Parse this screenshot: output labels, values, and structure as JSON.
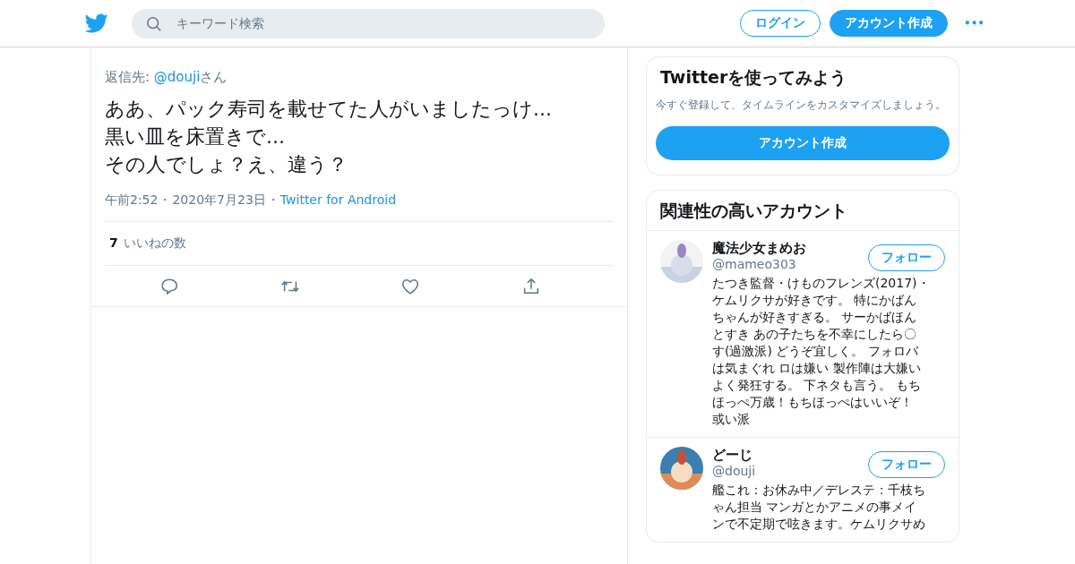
{
  "header": {
    "search": {
      "placeholder": "キーワード検索"
    },
    "login": "ログイン",
    "signup": "アカウント作成",
    "more": "•••"
  },
  "tweet": {
    "reply_label": "返信先:",
    "reply_to": "@douji",
    "reply_suffix": "さん",
    "lines": [
      "ああ、パック寿司を載せてた人がいましたっけ...",
      "黒い皿を床置きで...",
      "その人でしょ？え、違う？"
    ],
    "time": "午前2:52",
    "date": "2020年7月23日",
    "source": "Twitter for Android",
    "separator": "・",
    "likes": "7",
    "likes_label": "いいねの数"
  },
  "signup_card": {
    "title": "Twitterを使ってみよう",
    "text": "今すぐ登録して、タイムラインをカスタマイズしましょう。",
    "button": "アカウント作成"
  },
  "related": {
    "title": "関連性の高いアカウント",
    "accounts": [
      {
        "name": "魔法少女まめお",
        "handle": "@mameo303",
        "button": "フォロー",
        "bio": [
          "たつき監督・けものフレンズ(2017)・",
          "ケムリクサが好きです。 特にかばん",
          "ちゃんが好きすぎる。 サーかばほん",
          "とすき あの子たちを不幸にしたら〇",
          "す(過激派) どうぞ宜しく。 フォロバ",
          "は気まぐれ ロは嫌い 製作陣は大嫌い",
          "よく発狂する。 下ネタも言う。 もち",
          "ほっぺ万歳！もちほっぺはいいぞ！",
          "或い派"
        ]
      },
      {
        "name": "どーじ",
        "handle": "@douji",
        "button": "フォロー",
        "bio": [
          "艦これ：お休み中／デレステ：千枝ち",
          "ゃん担当 マンガとかアニメの事メイ",
          "ンで不定期で呟きます。ケムリクサめ"
        ]
      }
    ]
  }
}
